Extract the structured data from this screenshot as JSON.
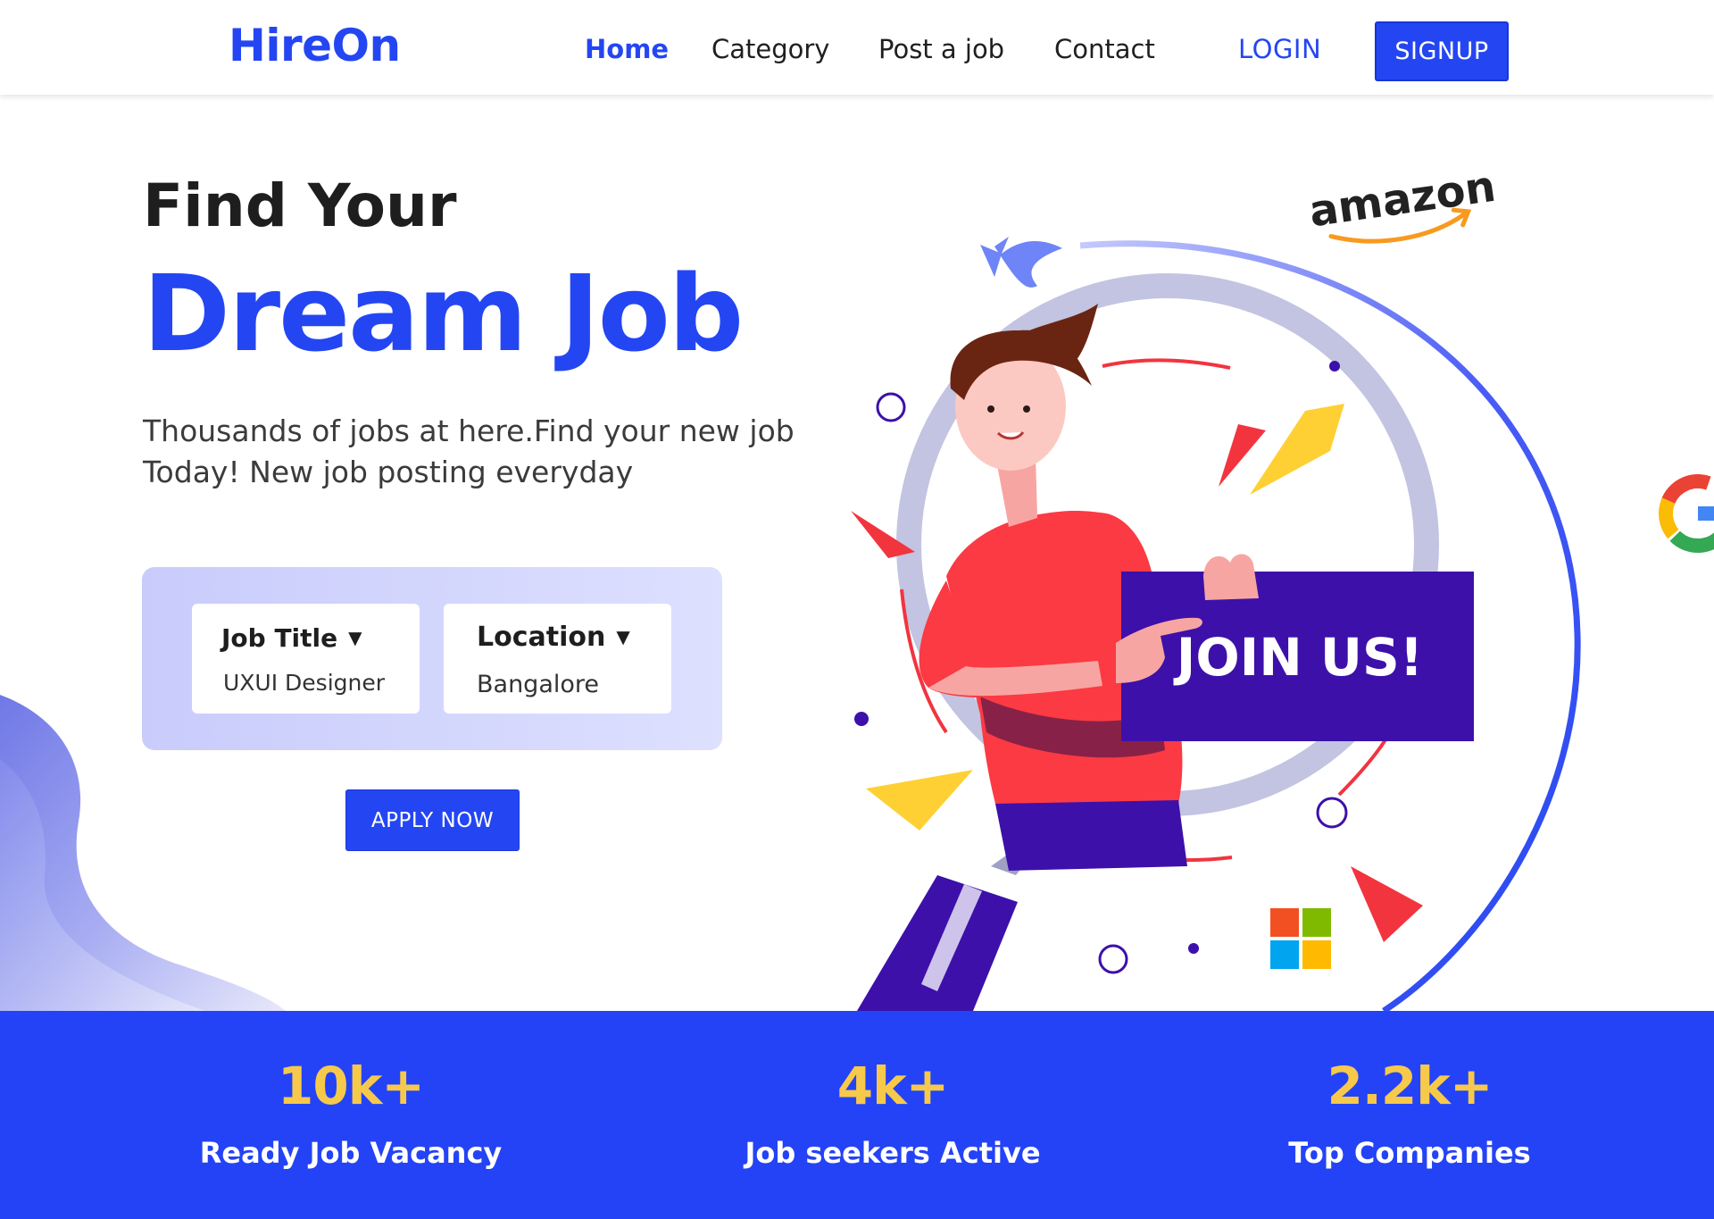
{
  "nav": {
    "logo": "HireOn",
    "links": [
      {
        "label": "Home",
        "active": true
      },
      {
        "label": "Category",
        "active": false
      },
      {
        "label": "Post a job",
        "active": false
      },
      {
        "label": "Contact",
        "active": false
      }
    ],
    "login_label": "LOGIN",
    "signup_label": "SIGNUP"
  },
  "hero": {
    "title_line1": "Find Your",
    "title_line2": "Dream Job",
    "subtitle_line1": "Thousands of jobs at here.Find your new job",
    "subtitle_line2": "Today! New job posting everyday"
  },
  "search": {
    "job_title": {
      "label": "Job Title",
      "value": "UXUI Designer"
    },
    "location": {
      "label": "Location",
      "value": "Bangalore"
    },
    "apply_label": "APPLY NOW"
  },
  "illustration": {
    "sign_text": "JOIN US!",
    "company_logos": [
      "amazon",
      "google-icon",
      "microsoft-icon"
    ],
    "amazon_wordmark": "amazon"
  },
  "stats": [
    {
      "value": "10k+",
      "label": "Ready Job Vacancy"
    },
    {
      "value": "4k+",
      "label": "Job seekers Active"
    },
    {
      "value": "2.2k+",
      "label": "Top Companies"
    }
  ],
  "colors": {
    "brand_blue": "#2446f2",
    "stats_bg": "#2443f6",
    "stat_value": "#f7c94b",
    "sign_purple": "#3d10aa",
    "shirt_red": "#fb3a44"
  }
}
